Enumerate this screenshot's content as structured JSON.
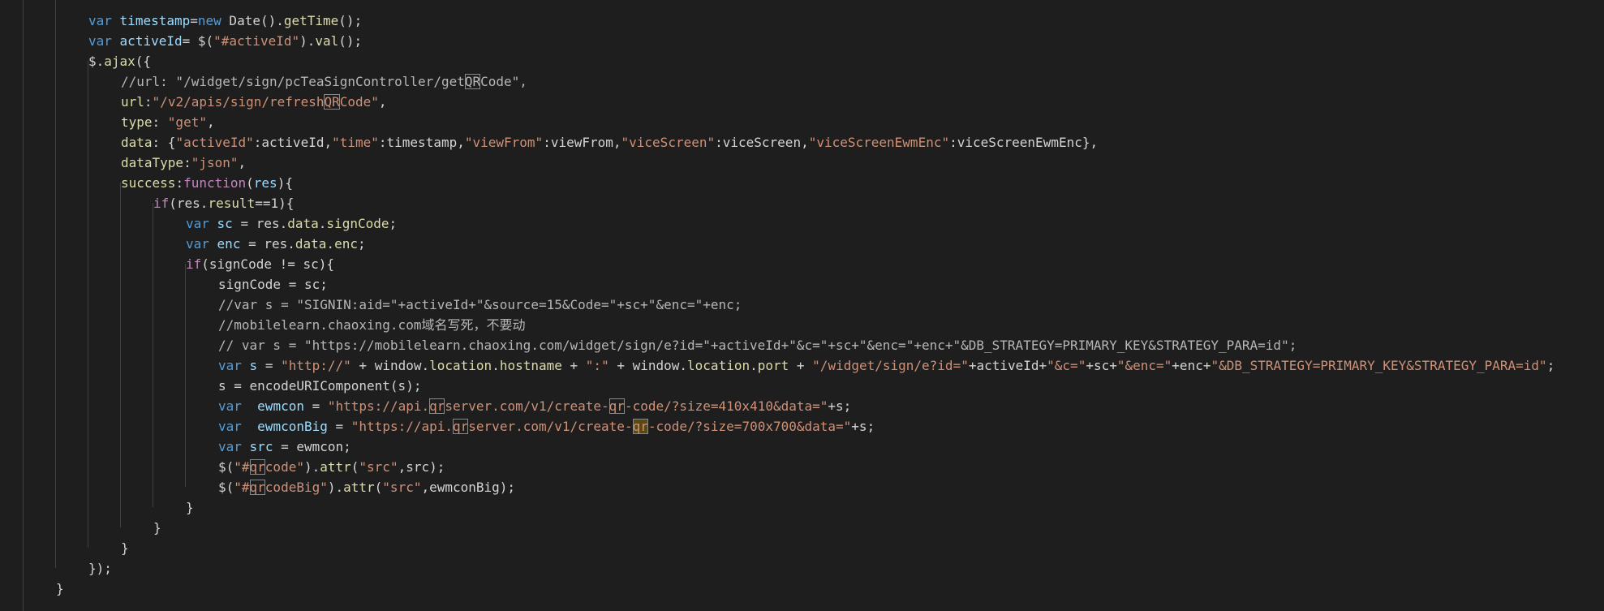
{
  "lines": [
    {
      "indent": 1,
      "tokens": [
        {
          "t": "var",
          "c": "storage"
        },
        {
          "t": " ",
          "c": "plain"
        },
        {
          "t": "timestamp",
          "c": "var"
        },
        {
          "t": "=",
          "c": "plain"
        },
        {
          "t": "new",
          "c": "storage"
        },
        {
          "t": " Date().",
          "c": "plain"
        },
        {
          "t": "getTime",
          "c": "func"
        },
        {
          "t": "();",
          "c": "plain"
        }
      ]
    },
    {
      "indent": 1,
      "tokens": [
        {
          "t": "var",
          "c": "storage"
        },
        {
          "t": " ",
          "c": "plain"
        },
        {
          "t": "activeId",
          "c": "var"
        },
        {
          "t": "= $(",
          "c": "plain"
        },
        {
          "t": "\"#activeId\"",
          "c": "string"
        },
        {
          "t": ").",
          "c": "plain"
        },
        {
          "t": "val",
          "c": "func"
        },
        {
          "t": "();",
          "c": "plain"
        }
      ]
    },
    {
      "indent": 1,
      "tokens": [
        {
          "t": "$.",
          "c": "plain"
        },
        {
          "t": "ajax",
          "c": "func"
        },
        {
          "t": "({",
          "c": "plain"
        }
      ]
    },
    {
      "indent": 2,
      "tokens": [
        {
          "t": "//url: \"/widget/sign/pcTeaSignController/get",
          "c": "comment"
        },
        {
          "t": "QR",
          "c": "comment",
          "m": "match"
        },
        {
          "t": "Code\",",
          "c": "comment"
        }
      ]
    },
    {
      "indent": 2,
      "tokens": [
        {
          "t": "url",
          "c": "prop"
        },
        {
          "t": ":",
          "c": "plain"
        },
        {
          "t": "\"/v2/apis/sign/refresh",
          "c": "string"
        },
        {
          "t": "QR",
          "c": "string",
          "m": "match"
        },
        {
          "t": "Code\"",
          "c": "string"
        },
        {
          "t": ",",
          "c": "plain"
        }
      ]
    },
    {
      "indent": 2,
      "tokens": [
        {
          "t": "type",
          "c": "prop"
        },
        {
          "t": ": ",
          "c": "plain"
        },
        {
          "t": "\"get\"",
          "c": "string"
        },
        {
          "t": ",",
          "c": "plain"
        }
      ]
    },
    {
      "indent": 2,
      "tokens": [
        {
          "t": "data",
          "c": "prop"
        },
        {
          "t": ": {",
          "c": "plain"
        },
        {
          "t": "\"activeId\"",
          "c": "string"
        },
        {
          "t": ":activeId,",
          "c": "plain"
        },
        {
          "t": "\"time\"",
          "c": "string"
        },
        {
          "t": ":timestamp,",
          "c": "plain"
        },
        {
          "t": "\"viewFrom\"",
          "c": "string"
        },
        {
          "t": ":viewFrom,",
          "c": "plain"
        },
        {
          "t": "\"viceScreen\"",
          "c": "string"
        },
        {
          "t": ":viceScreen,",
          "c": "plain"
        },
        {
          "t": "\"viceScreenEwmEnc\"",
          "c": "string"
        },
        {
          "t": ":viceScreenEwmEnc},",
          "c": "plain"
        }
      ]
    },
    {
      "indent": 2,
      "tokens": [
        {
          "t": "dataType",
          "c": "prop"
        },
        {
          "t": ":",
          "c": "plain"
        },
        {
          "t": "\"json\"",
          "c": "string"
        },
        {
          "t": ",",
          "c": "plain"
        }
      ]
    },
    {
      "indent": 2,
      "tokens": [
        {
          "t": "success",
          "c": "prop"
        },
        {
          "t": ":",
          "c": "plain"
        },
        {
          "t": "function",
          "c": "purple"
        },
        {
          "t": "(",
          "c": "plain"
        },
        {
          "t": "res",
          "c": "var"
        },
        {
          "t": "){",
          "c": "plain"
        }
      ]
    },
    {
      "indent": 3,
      "tokens": [
        {
          "t": "if",
          "c": "keyword"
        },
        {
          "t": "(res.",
          "c": "plain"
        },
        {
          "t": "result",
          "c": "prop"
        },
        {
          "t": "==1){",
          "c": "plain"
        }
      ]
    },
    {
      "indent": 4,
      "tokens": [
        {
          "t": "var",
          "c": "storage"
        },
        {
          "t": " ",
          "c": "plain"
        },
        {
          "t": "sc",
          "c": "var"
        },
        {
          "t": " = res.",
          "c": "plain"
        },
        {
          "t": "data",
          "c": "prop"
        },
        {
          "t": ".",
          "c": "plain"
        },
        {
          "t": "signCode",
          "c": "prop"
        },
        {
          "t": ";",
          "c": "plain"
        }
      ]
    },
    {
      "indent": 4,
      "tokens": [
        {
          "t": "var",
          "c": "storage"
        },
        {
          "t": " ",
          "c": "plain"
        },
        {
          "t": "enc",
          "c": "var"
        },
        {
          "t": " = res.",
          "c": "plain"
        },
        {
          "t": "data",
          "c": "prop"
        },
        {
          "t": ".",
          "c": "plain"
        },
        {
          "t": "enc",
          "c": "prop"
        },
        {
          "t": ";",
          "c": "plain"
        }
      ]
    },
    {
      "indent": 4,
      "tokens": [
        {
          "t": "if",
          "c": "keyword"
        },
        {
          "t": "(signCode != sc){",
          "c": "plain"
        }
      ]
    },
    {
      "indent": 5,
      "tokens": [
        {
          "t": "signCode = sc;",
          "c": "plain"
        }
      ]
    },
    {
      "indent": 5,
      "tokens": [
        {
          "t": "//var s = \"SIGNIN:aid=\"+activeId+\"&source=15&Code=\"+sc+\"&enc=\"+enc;",
          "c": "comment"
        }
      ]
    },
    {
      "indent": 5,
      "tokens": [
        {
          "t": "//mobilelearn.chaoxing.com域名写死，不要动",
          "c": "comment"
        }
      ]
    },
    {
      "indent": 5,
      "tokens": [
        {
          "t": "// var s = \"https://mobilelearn.chaoxing.com/widget/sign/e?id=\"+activeId+\"&c=\"+sc+\"&enc=\"+enc+\"&DB_STRATEGY=PRIMARY_KEY&STRATEGY_PARA=id\";",
          "c": "comment"
        }
      ]
    },
    {
      "indent": 5,
      "tokens": [
        {
          "t": "var",
          "c": "storage"
        },
        {
          "t": " ",
          "c": "plain"
        },
        {
          "t": "s",
          "c": "var"
        },
        {
          "t": " = ",
          "c": "plain"
        },
        {
          "t": "\"http://\"",
          "c": "string"
        },
        {
          "t": " + window.",
          "c": "plain"
        },
        {
          "t": "location",
          "c": "prop"
        },
        {
          "t": ".",
          "c": "plain"
        },
        {
          "t": "hostname",
          "c": "prop"
        },
        {
          "t": " + ",
          "c": "plain"
        },
        {
          "t": "\":\"",
          "c": "string"
        },
        {
          "t": " + window.",
          "c": "plain"
        },
        {
          "t": "location",
          "c": "prop"
        },
        {
          "t": ".",
          "c": "plain"
        },
        {
          "t": "port",
          "c": "prop"
        },
        {
          "t": " + ",
          "c": "plain"
        },
        {
          "t": "\"/widget/sign/e?id=\"",
          "c": "string"
        },
        {
          "t": "+activeId+",
          "c": "plain"
        },
        {
          "t": "\"&c=\"",
          "c": "string"
        },
        {
          "t": "+sc+",
          "c": "plain"
        },
        {
          "t": "\"&enc=\"",
          "c": "string"
        },
        {
          "t": "+enc+",
          "c": "plain"
        },
        {
          "t": "\"&DB_STRATEGY=PRIMARY_KEY&STRATEGY_PARA=id\"",
          "c": "string"
        },
        {
          "t": ";",
          "c": "plain"
        }
      ]
    },
    {
      "indent": 5,
      "tokens": [
        {
          "t": "s = encodeURIComponent(s);",
          "c": "plain"
        }
      ]
    },
    {
      "indent": 5,
      "tokens": [
        {
          "t": "var",
          "c": "storage"
        },
        {
          "t": "  ",
          "c": "plain"
        },
        {
          "t": "ewmcon",
          "c": "var"
        },
        {
          "t": " = ",
          "c": "plain"
        },
        {
          "t": "\"https://api.",
          "c": "string"
        },
        {
          "t": "qr",
          "c": "string",
          "m": "match"
        },
        {
          "t": "server.com/v1/create-",
          "c": "string"
        },
        {
          "t": "qr",
          "c": "string",
          "m": "match"
        },
        {
          "t": "-code/?size=410x410&data=\"",
          "c": "string"
        },
        {
          "t": "+s;",
          "c": "plain"
        }
      ]
    },
    {
      "indent": 5,
      "tokens": [
        {
          "t": "var",
          "c": "storage"
        },
        {
          "t": "  ",
          "c": "plain"
        },
        {
          "t": "ewmconBig",
          "c": "var"
        },
        {
          "t": " = ",
          "c": "plain"
        },
        {
          "t": "\"https://api.",
          "c": "string"
        },
        {
          "t": "qr",
          "c": "string",
          "m": "match"
        },
        {
          "t": "server.com/v1/create-",
          "c": "string"
        },
        {
          "t": "qr",
          "c": "string",
          "m": "current"
        },
        {
          "t": "-code/?size=700x700&data=\"",
          "c": "string"
        },
        {
          "t": "+s;",
          "c": "plain"
        }
      ]
    },
    {
      "indent": 5,
      "tokens": [
        {
          "t": "var",
          "c": "storage"
        },
        {
          "t": " ",
          "c": "plain"
        },
        {
          "t": "src",
          "c": "var"
        },
        {
          "t": " = ewmcon;",
          "c": "plain"
        }
      ]
    },
    {
      "indent": 5,
      "tokens": [
        {
          "t": "$(",
          "c": "plain"
        },
        {
          "t": "\"#",
          "c": "string"
        },
        {
          "t": "qr",
          "c": "string",
          "m": "match"
        },
        {
          "t": "code\"",
          "c": "string"
        },
        {
          "t": ").",
          "c": "plain"
        },
        {
          "t": "attr",
          "c": "func"
        },
        {
          "t": "(",
          "c": "plain"
        },
        {
          "t": "\"src\"",
          "c": "string"
        },
        {
          "t": ",src);",
          "c": "plain"
        }
      ]
    },
    {
      "indent": 5,
      "tokens": [
        {
          "t": "$(",
          "c": "plain"
        },
        {
          "t": "\"#",
          "c": "string"
        },
        {
          "t": "qr",
          "c": "string",
          "m": "match"
        },
        {
          "t": "codeBig\"",
          "c": "string"
        },
        {
          "t": ").",
          "c": "plain"
        },
        {
          "t": "attr",
          "c": "func"
        },
        {
          "t": "(",
          "c": "plain"
        },
        {
          "t": "\"src\"",
          "c": "string"
        },
        {
          "t": ",ewmconBig);",
          "c": "plain"
        }
      ]
    },
    {
      "indent": 4,
      "tokens": [
        {
          "t": "}",
          "c": "plain"
        }
      ]
    },
    {
      "indent": 3,
      "tokens": [
        {
          "t": "}",
          "c": "plain"
        }
      ]
    },
    {
      "indent": 2,
      "tokens": [
        {
          "t": "}",
          "c": "plain"
        }
      ]
    },
    {
      "indent": 1,
      "tokens": [
        {
          "t": "});",
          "c": "plain"
        }
      ]
    },
    {
      "indent": 0,
      "tokens": [
        {
          "t": "}",
          "c": "plain"
        }
      ]
    }
  ]
}
